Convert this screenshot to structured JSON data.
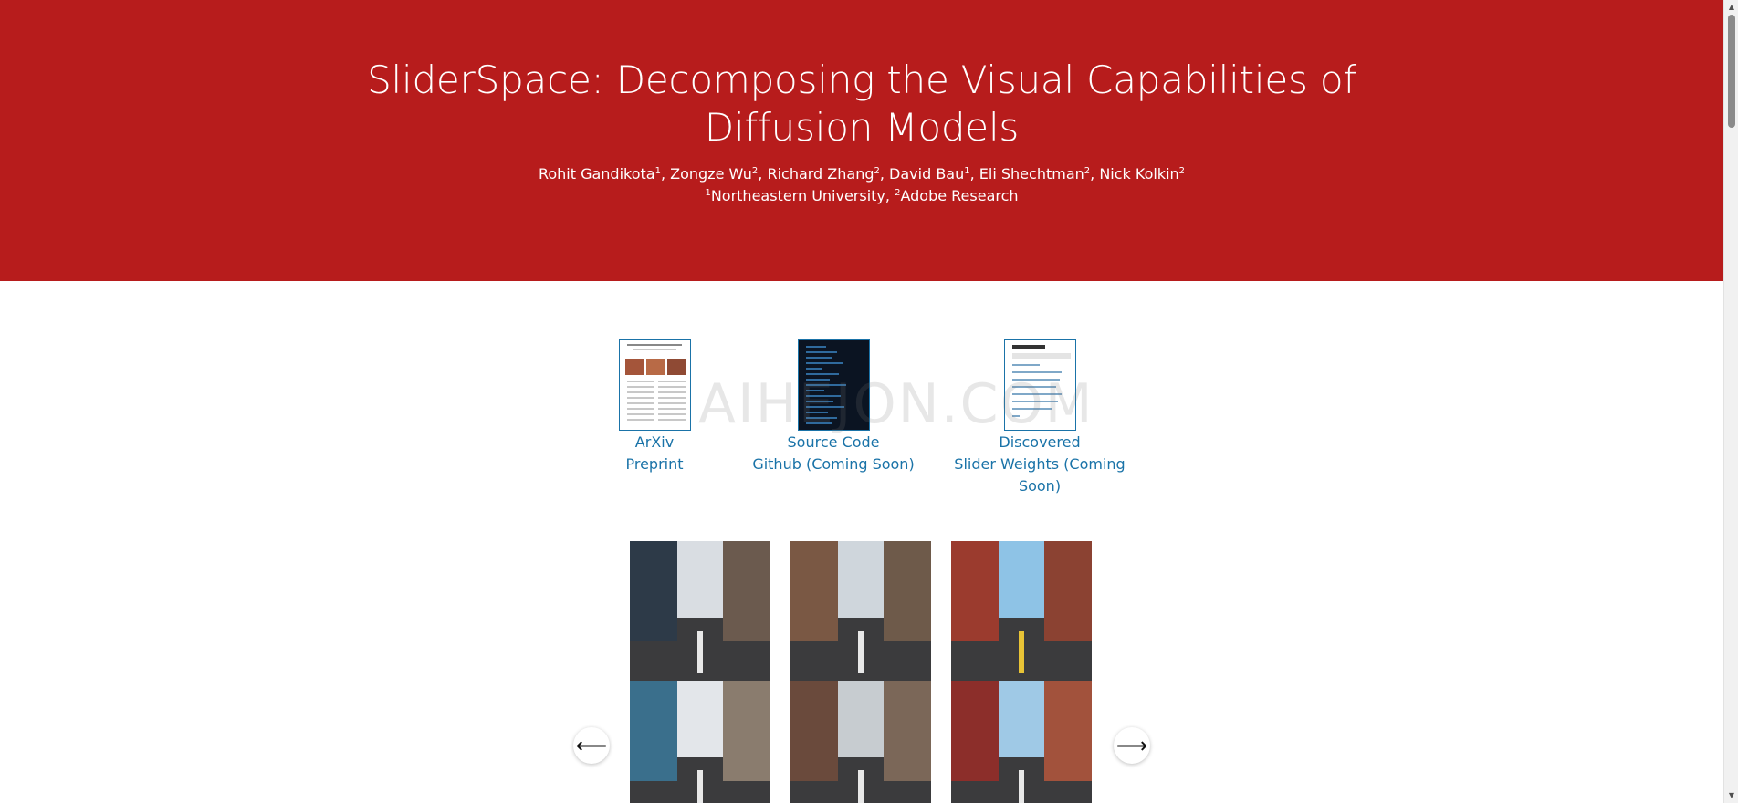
{
  "header": {
    "title": "SliderSpace: Decomposing the Visual Capabilities of Diffusion Models",
    "authors": [
      {
        "name": "Rohit Gandikota",
        "sup": "1"
      },
      {
        "name": "Zongze Wu",
        "sup": "2"
      },
      {
        "name": "Richard Zhang",
        "sup": "2"
      },
      {
        "name": "David Bau",
        "sup": "1"
      },
      {
        "name": "Eli Shechtman",
        "sup": "2"
      },
      {
        "name": "Nick Kolkin",
        "sup": "2"
      }
    ],
    "affiliations": [
      {
        "sup": "1",
        "name": "Northeastern University"
      },
      {
        "sup": "2",
        "name": "Adobe Research"
      }
    ],
    "background_color": "#b71c1c"
  },
  "links": [
    {
      "line1": "ArXiv",
      "line2": "Preprint",
      "icon": "paper-thumbnail"
    },
    {
      "line1": "Source Code",
      "line2": "Github (Coming Soon)",
      "icon": "code-thumbnail"
    },
    {
      "line1": "Discovered",
      "line2": "Slider Weights (Coming Soon)",
      "icon": "index-thumbnail"
    }
  ],
  "link_color": "#1a73a8",
  "watermark": "AIHEJON.COM",
  "carousel": {
    "prev_icon": "⟵",
    "next_icon": "⟶",
    "images": [
      {
        "name": "city-street-1",
        "sky": "#d9dde2",
        "left": "#2d3a48",
        "right": "#6b5a4e",
        "lane": "white"
      },
      {
        "name": "city-street-2",
        "sky": "#cfd6dc",
        "left": "#7a5844",
        "right": "#6e5a4a",
        "lane": "white"
      },
      {
        "name": "city-street-3",
        "sky": "#8ec3e6",
        "left": "#9b3b2e",
        "right": "#8b4232",
        "lane": "yellow"
      },
      {
        "name": "city-street-4",
        "sky": "#e3e6ea",
        "left": "#3a6f8c",
        "right": "#8a7c6e",
        "lane": "white"
      },
      {
        "name": "city-street-5",
        "sky": "#c7ccd0",
        "left": "#6a4a3c",
        "right": "#7b6758",
        "lane": "white"
      },
      {
        "name": "city-street-6",
        "sky": "#9fc9e6",
        "left": "#8c2e2a",
        "right": "#a2523c",
        "lane": "white"
      }
    ]
  }
}
